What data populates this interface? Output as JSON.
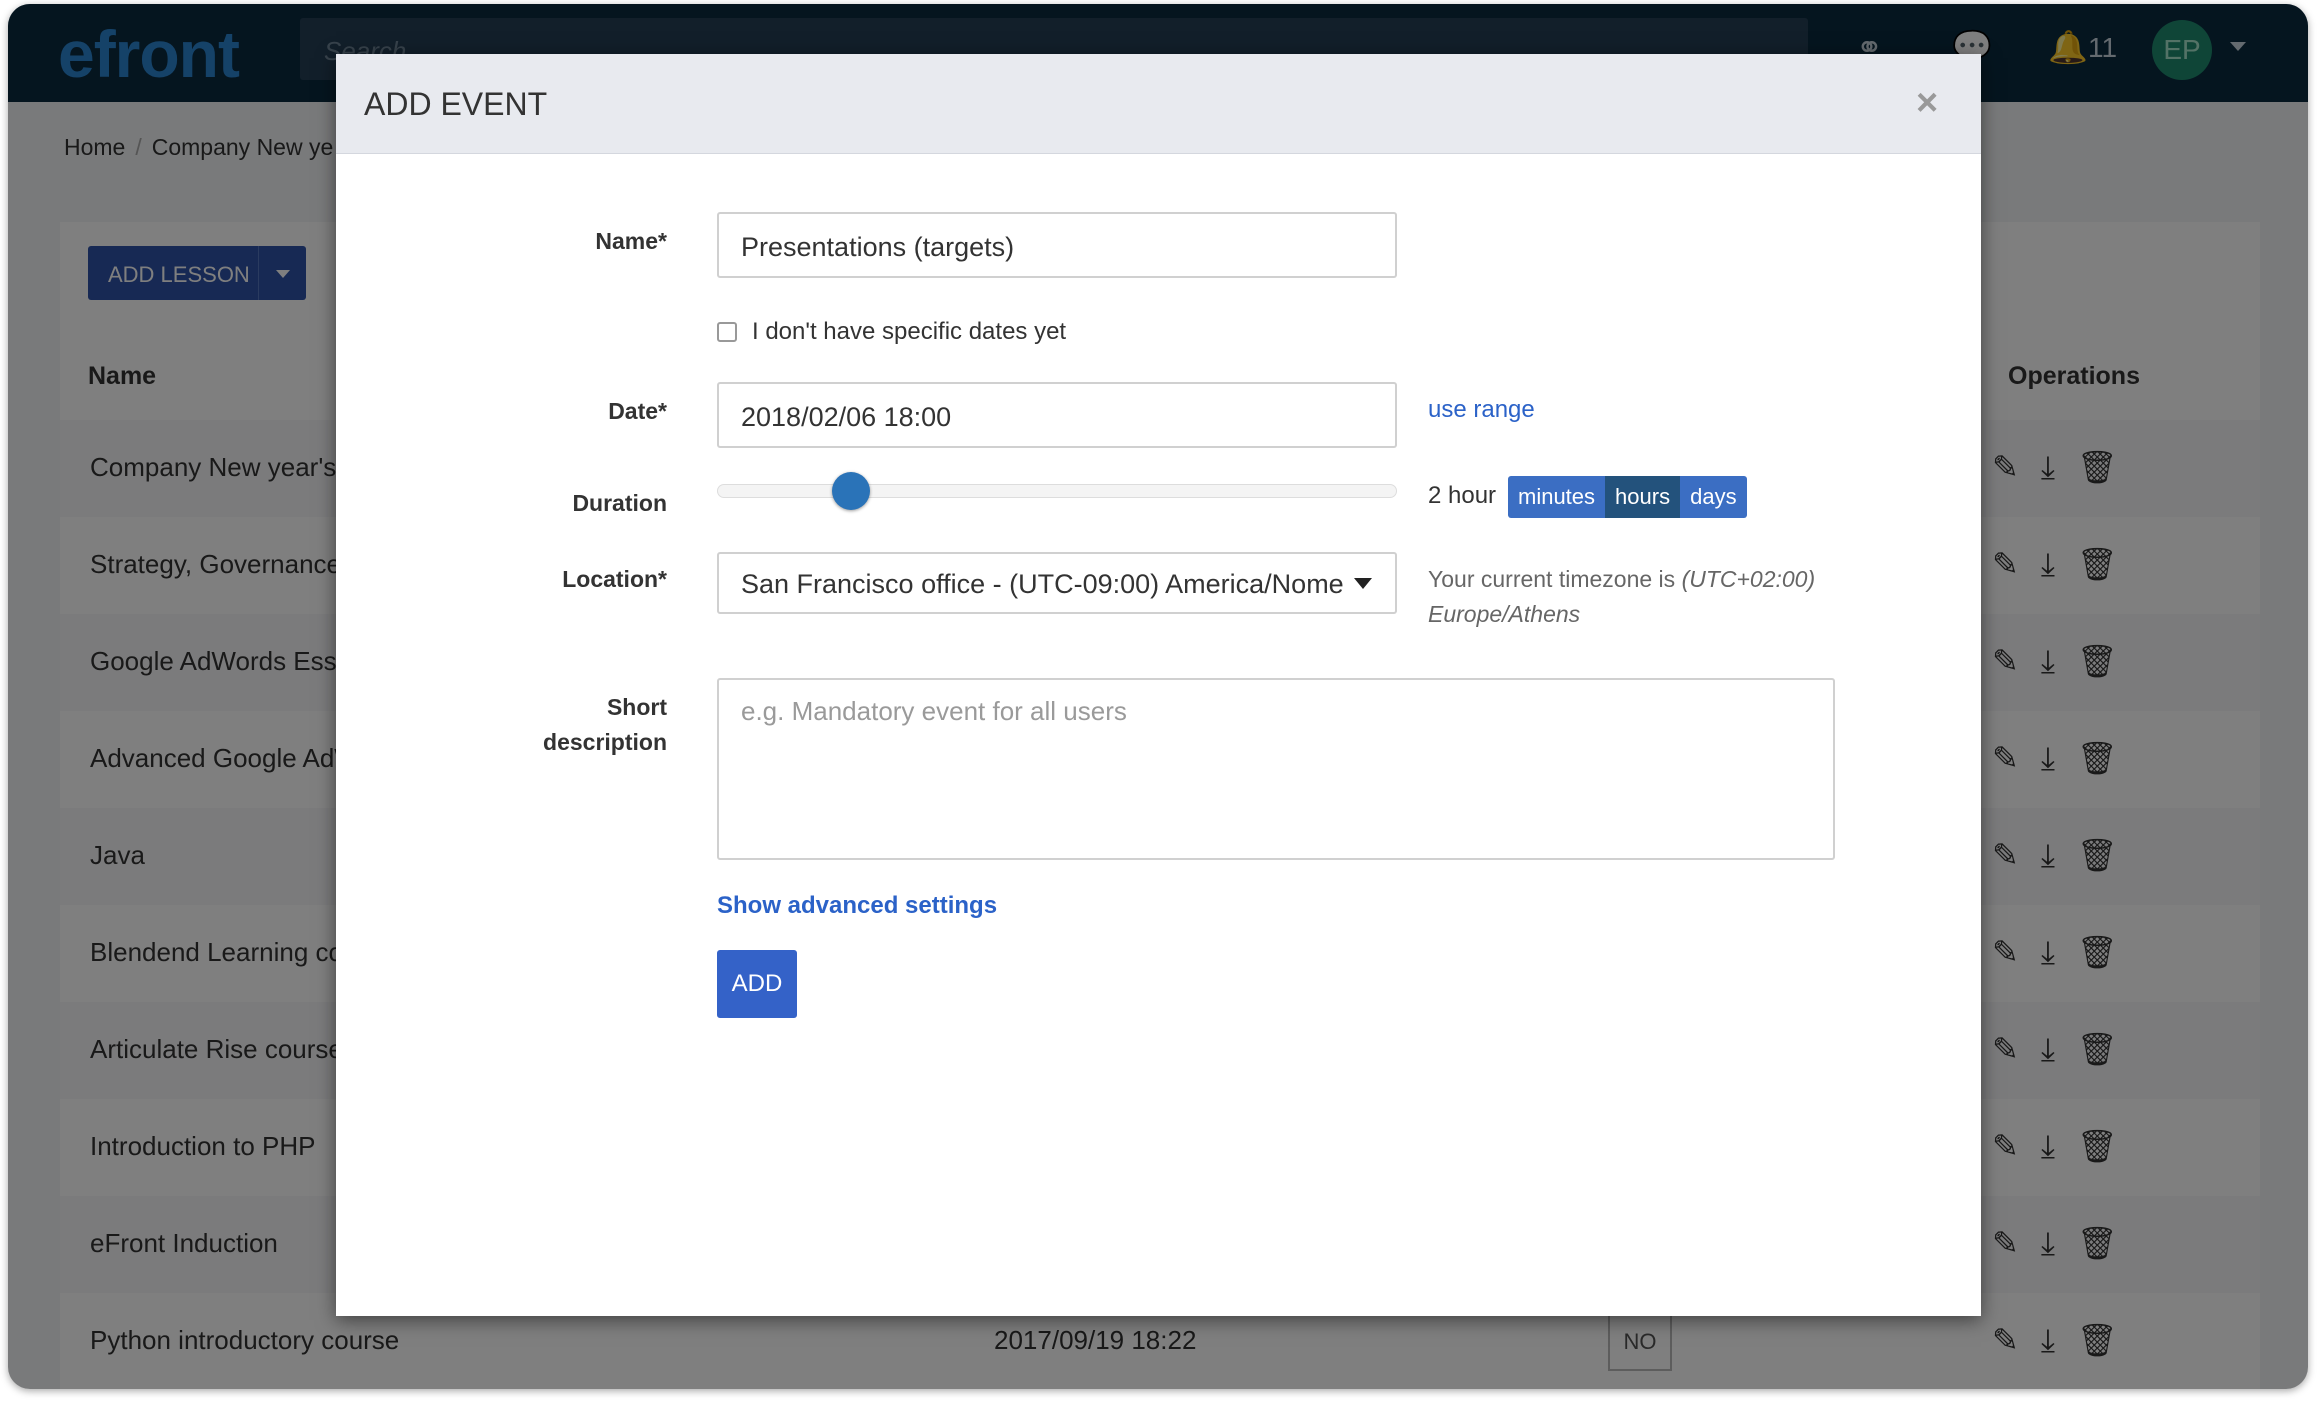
{
  "app": {
    "logo": "efront",
    "search_placeholder": "Search",
    "notification_count": "11",
    "user_initials": "EP"
  },
  "breadcrumb": [
    "Home",
    "Company New ye"
  ],
  "toolbar": {
    "add_lesson_label": "ADD LESSON"
  },
  "table": {
    "headers": {
      "name": "Name",
      "operations": "Operations"
    },
    "rows": [
      {
        "name": "Company New year's r"
      },
      {
        "name": "Strategy, Governance a"
      },
      {
        "name": "Google AdWords Esse"
      },
      {
        "name": "Advanced Google AdW"
      },
      {
        "name": "Java"
      },
      {
        "name": "Blendend Learning co"
      },
      {
        "name": "Articulate Rise course"
      },
      {
        "name": "Introduction to PHP"
      },
      {
        "name": "eFront Induction"
      },
      {
        "name": "Python introductory course",
        "date": "2017/09/19 18:22",
        "badge": "NO"
      }
    ]
  },
  "modal": {
    "title": "ADD EVENT",
    "close": "×",
    "name_label": "Name*",
    "name_value": "Presentations (targets)",
    "no_dates_label": "I don't have specific dates yet",
    "date_label": "Date*",
    "date_value": "2018/02/06 18:00",
    "use_range": "use range",
    "duration_label": "Duration",
    "duration_value": "2 hour",
    "duration_units": [
      "minutes",
      "hours",
      "days"
    ],
    "duration_selected_unit": "hours",
    "location_label": "Location*",
    "location_value": "San Francisco office - (UTC-09:00) America/Nome",
    "tz_prefix": "Your current timezone is",
    "tz_offset": "(UTC+02:00)",
    "tz_zone": "Europe/Athens",
    "short_label_1": "Short",
    "short_label_2": "description",
    "desc_placeholder": "e.g. Mandatory event for all users",
    "advanced_link": "Show advanced settings",
    "submit_label": "ADD"
  },
  "colors": {
    "accent": "#3462c8",
    "topbar": "#0b2a3f",
    "logo": "#2a84d0"
  }
}
